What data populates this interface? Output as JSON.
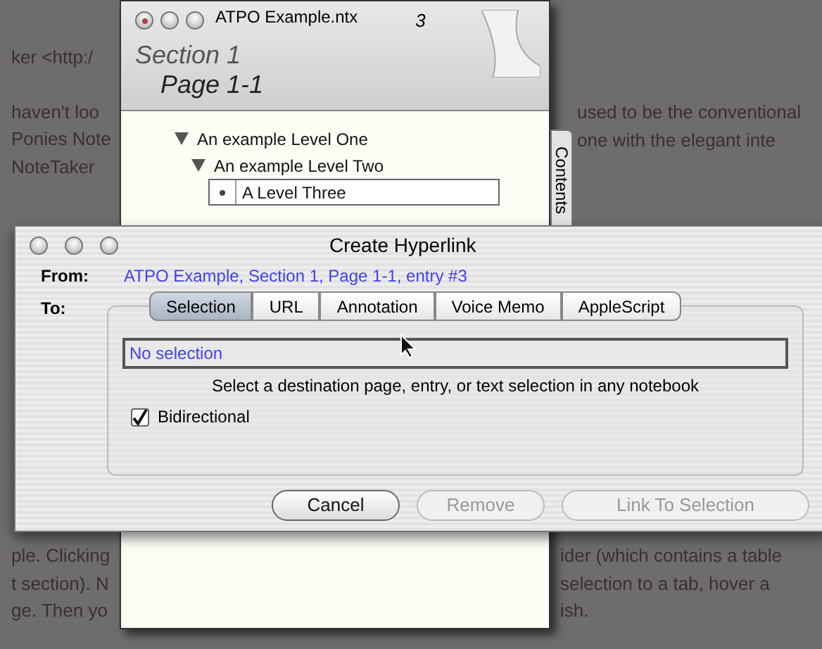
{
  "background_top_left": [
    [
      "ker <http:/"
    ],
    [
      "haven't loo",
      "Ponies Note",
      "NoteTaker"
    ]
  ],
  "background_top_right": [
    "used to be the conventional",
    "one with the elegant inte"
  ],
  "background_bottom_left": [
    "ple. Clicking",
    "t section). N",
    "ge. Then yo"
  ],
  "background_bottom_right": [
    "ider (which contains a table",
    "selection to a tab, hover a",
    "ish."
  ],
  "notebook": {
    "title": "ATPO Example.ntx",
    "page_number": "3",
    "section": "Section 1",
    "page": "Page 1-1",
    "side_tab": "Contents",
    "entries": [
      {
        "text": "An example Level One",
        "expanded": true,
        "children": [
          {
            "text": "An example Level Two",
            "expanded": true,
            "children": [
              {
                "text": "A Level Three",
                "selected": true
              }
            ]
          }
        ]
      }
    ]
  },
  "dialog": {
    "title": "Create Hyperlink",
    "from_label": "From:",
    "from_value": "ATPO Example, Section 1, Page 1-1, entry #3",
    "to_label": "To:",
    "tabs": [
      {
        "label": "Selection",
        "selected": true
      },
      {
        "label": "URL",
        "selected": false
      },
      {
        "label": "Annotation",
        "selected": false
      },
      {
        "label": "Voice Memo",
        "selected": false
      },
      {
        "label": "AppleScript",
        "selected": false
      }
    ],
    "field": {
      "value": "No selection"
    },
    "hint": "Select a destination page, entry, or text selection in any notebook",
    "checkbox": {
      "label": "Bidirectional",
      "checked": true
    },
    "buttons": [
      {
        "label": "Cancel",
        "disabled": false
      },
      {
        "label": "Remove",
        "disabled": true
      },
      {
        "label": "Link To Selection",
        "disabled": true
      }
    ]
  }
}
